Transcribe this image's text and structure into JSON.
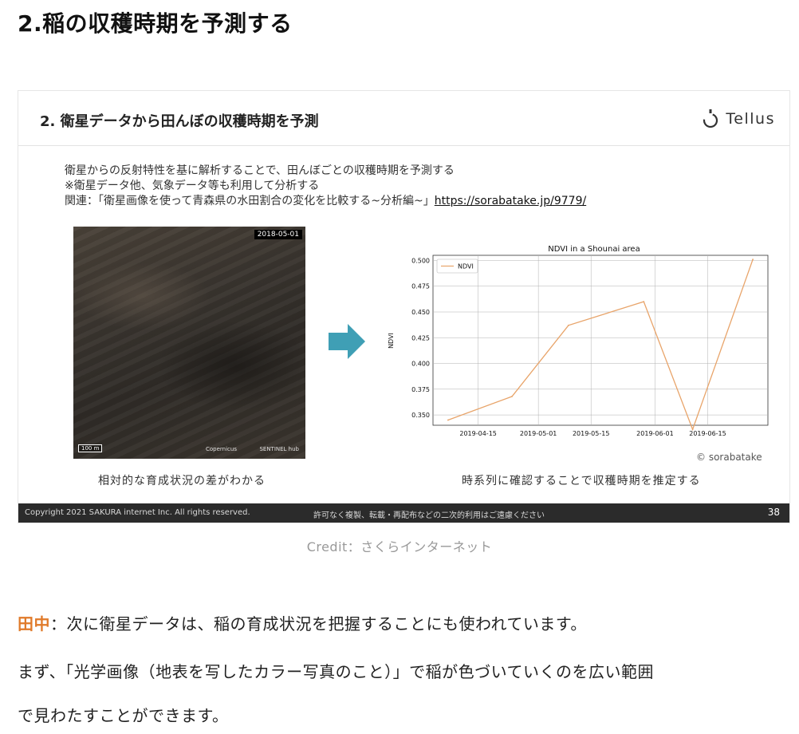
{
  "heading": "2.稲の収穫時期を予測する",
  "slide": {
    "title": "2. 衛星データから田んぼの収穫時期を予測",
    "logo_text": "Tellus",
    "desc_lines": [
      "衛星からの反射特性を基に解析することで、田んぼごとの収穫時期を予測する",
      "※衛星データ他、気象データ等も利用して分析する"
    ],
    "desc_related_prefix": "関連：「衛星画像を使って青森県の水田割合の変化を比較する~分析編~」",
    "desc_related_link": "https://sorabatake.jp/9779/",
    "image": {
      "date_label": "2018-05-01",
      "scale_label": "100 m",
      "brand_copernicus": "Copernicus",
      "brand_sentinel": "SENTINEL hub"
    },
    "caption_left": "相対的な育成状況の差がわかる",
    "caption_right": "時系列に確認することで収穫時期を推定する",
    "chart_credit": "© sorabatake",
    "footer": {
      "copyright": "Copyright 2021 SAKURA internet Inc. All rights reserved.",
      "notice": "許可なく複製、転載・再配布などの二次的利用はご遠慮ください",
      "page": "38"
    },
    "arrow_color": "#3f9fb5"
  },
  "chart_data": {
    "type": "line",
    "title": "NDVI in a Shounai area",
    "xlabel": "",
    "ylabel": "NDVI",
    "x_ticks": [
      "2019-04-15",
      "2019-05-01",
      "2019-05-15",
      "2019-06-01",
      "2019-06-15"
    ],
    "y_ticks": [
      "0.350",
      "0.375",
      "0.400",
      "0.425",
      "0.450",
      "0.475",
      "0.500"
    ],
    "ylim": [
      0.34,
      0.505
    ],
    "xlim": [
      "2019-04-03",
      "2019-07-01"
    ],
    "grid": true,
    "legend": "top-left",
    "series": [
      {
        "name": "NDVI",
        "color": "#e8a46a",
        "x": [
          "2019-04-07",
          "2019-04-24",
          "2019-05-09",
          "2019-05-29",
          "2019-06-11",
          "2019-06-27"
        ],
        "y": [
          0.345,
          0.368,
          0.437,
          0.46,
          0.336,
          0.501
        ]
      }
    ]
  },
  "credit": "Credit：さくらインターネット",
  "paragraphs": {
    "speaker": "田中",
    "line1": "：次に衛星データは、稲の育成状況を把握することにも使われています。",
    "line2": "まず、「光学画像（地表を写したカラー写真のこと）」で稲が色づいていくのを広い範囲",
    "line3": "で見わたすことができます。"
  }
}
